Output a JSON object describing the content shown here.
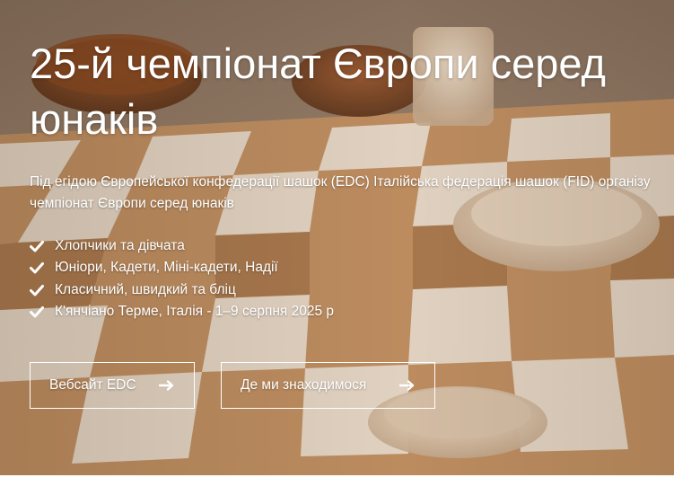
{
  "hero": {
    "title": "25-й чемпіонат Європи серед юнаків",
    "lead_line1": "Під егідою Європейської конфедерації шашок (EDC) Італійська федерація шашок (FID) організу",
    "lead_line2": "чемпіонат Європи серед юнаків",
    "features": [
      "Хлопчики та дівчата",
      "Юніори, Кадети, Міні-кадети, Надії",
      "Класичний, швидкий та бліц",
      "К'янчіано Терме, Італія - 1–9 серпня 2025 р"
    ],
    "check_icon": "check-icon",
    "arrow_icon": "arrow-right-icon"
  },
  "buttons": {
    "edc_label": "Вебсайт EDC",
    "location_label": "Де ми знаходимося"
  }
}
